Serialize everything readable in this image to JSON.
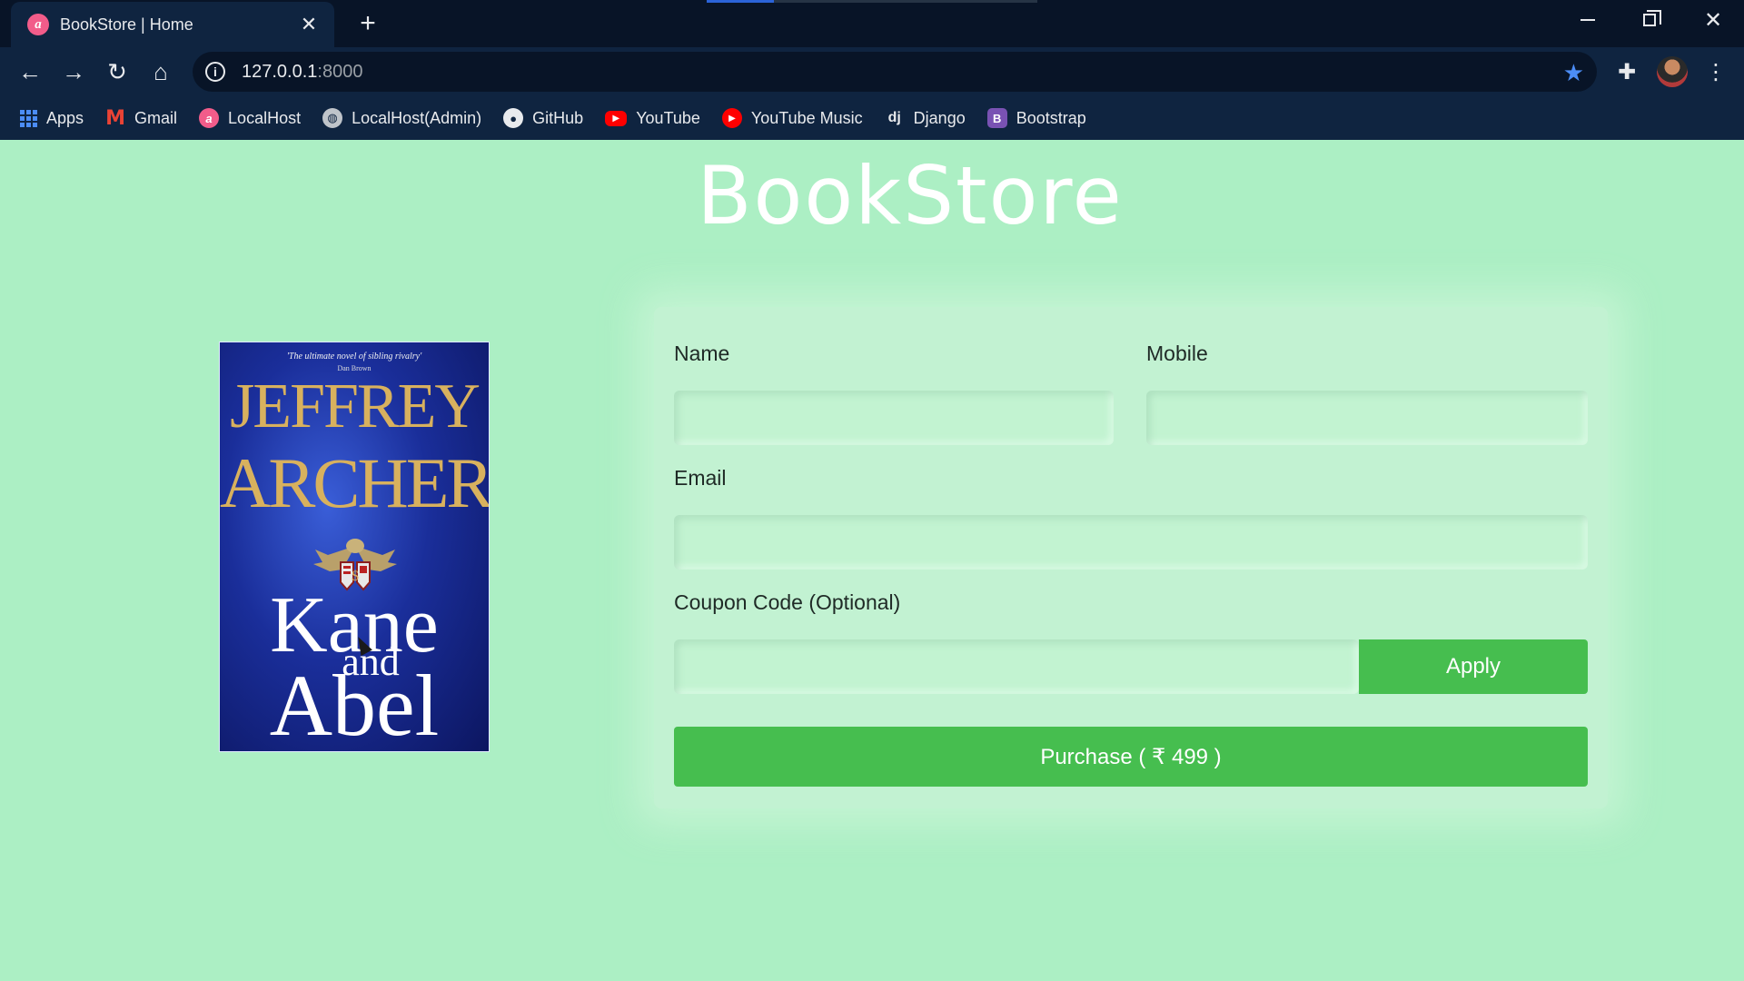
{
  "browser": {
    "tab_title": "BookStore | Home",
    "tab_favicon_letter": "a",
    "url_host": "127.0.0.1",
    "url_port": ":8000",
    "bookmarks": [
      {
        "label": "Apps",
        "icon": "apps-grid-icon"
      },
      {
        "label": "Gmail",
        "icon": "gmail-icon"
      },
      {
        "label": "LocalHost",
        "icon": "localhost-icon"
      },
      {
        "label": "LocalHost(Admin)",
        "icon": "globe-icon"
      },
      {
        "label": "GitHub",
        "icon": "github-icon"
      },
      {
        "label": "YouTube",
        "icon": "youtube-icon"
      },
      {
        "label": "YouTube Music",
        "icon": "youtube-music-icon"
      },
      {
        "label": "Django",
        "icon": "django-icon"
      },
      {
        "label": "Bootstrap",
        "icon": "bootstrap-icon"
      }
    ],
    "bookmark_glyphs": {
      "gmail": "M",
      "localhost": "a",
      "github": "",
      "youtube": "▶",
      "youtube_music": "▶",
      "django": "dj",
      "bootstrap": "B"
    }
  },
  "page": {
    "brand": "BookStore",
    "book_cover": {
      "quote": "'The ultimate novel of sibling rivalry'",
      "quote_by": "Dan Brown",
      "author_first": "JEFFREY",
      "author_last": "ARCHER",
      "title_line1": "Kane",
      "title_and": "and",
      "title_line2": "Abel"
    },
    "form": {
      "name_label": "Name",
      "name_value": "",
      "mobile_label": "Mobile",
      "mobile_value": "",
      "email_label": "Email",
      "email_value": "",
      "coupon_label": "Coupon Code (Optional)",
      "coupon_value": "",
      "apply_label": "Apply",
      "purchase_label": "Purchase ( ₹ 499 )"
    }
  },
  "colors": {
    "page_bg": "#acefc4",
    "button_green": "#46be4f",
    "chrome_dark": "#0f2440",
    "star_blue": "#4c8df6"
  }
}
